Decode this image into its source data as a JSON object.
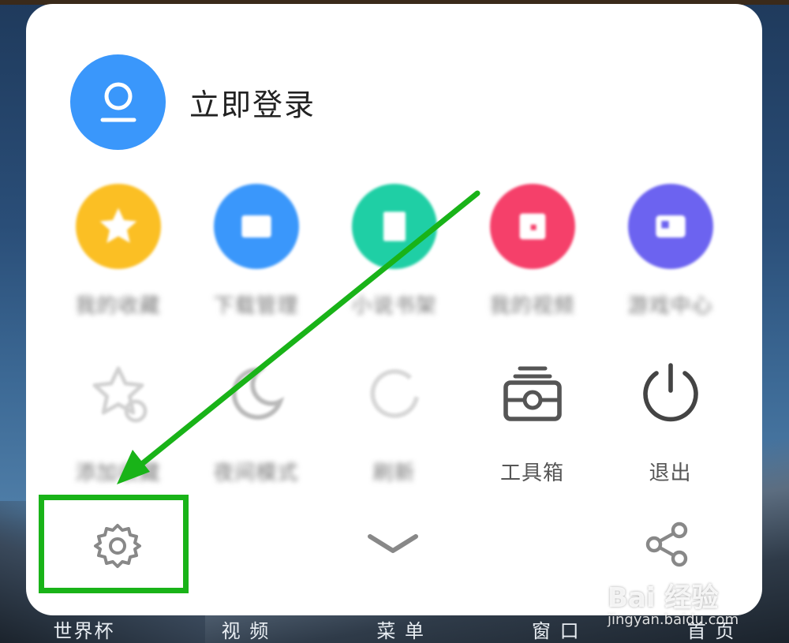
{
  "login": {
    "label": "立即登录"
  },
  "row1": [
    {
      "label": "我的收藏",
      "color": "#fbbf24",
      "icon": "star-icon"
    },
    {
      "label": "下载管理",
      "color": "#3a97fb",
      "icon": "folder-icon"
    },
    {
      "label": "小说书架",
      "color": "#1fcfa5",
      "icon": "book-icon"
    },
    {
      "label": "我的视频",
      "color": "#f5406a",
      "icon": "video-icon"
    },
    {
      "label": "游戏中心",
      "color": "#6c63f0",
      "icon": "game-icon"
    }
  ],
  "row2": [
    {
      "label": "添加收藏",
      "icon": "star-add-icon"
    },
    {
      "label": "夜间模式",
      "icon": "moon-icon"
    },
    {
      "label": "刷新",
      "icon": "refresh-icon"
    },
    {
      "label": "工具箱",
      "icon": "toolbox-icon"
    },
    {
      "label": "退出",
      "icon": "power-icon"
    }
  ],
  "bottom": {
    "settings": "settings-icon",
    "collapse": "chevron-down-icon",
    "share": "share-icon"
  },
  "tabbar": [
    "世界杯",
    "视 频",
    "菜 单",
    "窗 口",
    "首 页"
  ],
  "colors": {
    "highlight": "#19b318",
    "accent": "#3a97fb"
  },
  "watermark": {
    "brand": "Bai 经验",
    "url": "jingyan.baidu.com"
  }
}
